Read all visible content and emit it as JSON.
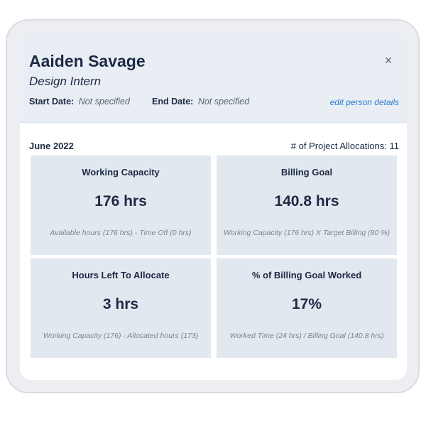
{
  "person": {
    "name": "Aaiden Savage",
    "role": "Design Intern",
    "start_date_label": "Start Date:",
    "start_date_value": "Not specified",
    "end_date_label": "End Date:",
    "end_date_value": "Not specified",
    "edit_link": "edit person details",
    "close_icon": "×"
  },
  "summary": {
    "period": "June 2022",
    "allocations": "# of Project Allocations: 11"
  },
  "tiles": [
    {
      "title": "Working Capacity",
      "value": "176 hrs",
      "note": "Available hours (176 hrs) - Time Off (0 hrs)"
    },
    {
      "title": "Billing Goal",
      "value": "140.8 hrs",
      "note": "Working Capacity (176 hrs) X Target Billing (80 %)"
    },
    {
      "title": "Hours Left To Allocate",
      "value": "3 hrs",
      "note": "Working Capacity (176) - Allocated hours (173)"
    },
    {
      "title": "% of Billing Goal Worked",
      "value": "17%",
      "note": "Worked Time (24 hrs) / Billing Goal (140.8 hrs)"
    }
  ],
  "colors": {
    "accent_link": "#2b7cd3",
    "header_bg": "#e9eef4",
    "tile_bg": "#e2e8ef",
    "text_primary": "#1c2a44"
  }
}
